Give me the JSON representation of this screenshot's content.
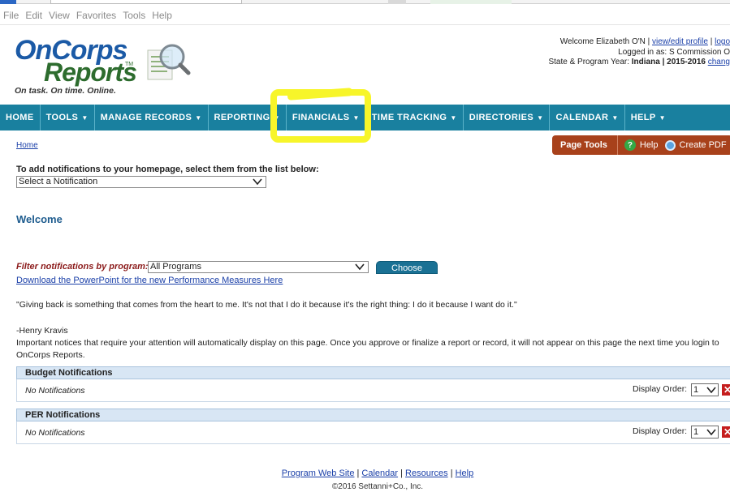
{
  "browser_menu": [
    "File",
    "Edit",
    "View",
    "Favorites",
    "Tools",
    "Help"
  ],
  "logo": {
    "line1": "OnCorps",
    "line2": "Reports",
    "tm": "TM",
    "tagline": "On task. On time. Online."
  },
  "header": {
    "welcome_prefix": "Welcome",
    "welcome_name": "Elizabeth O'N",
    "view_profile": "view/edit profile",
    "logout": "logo",
    "logged_in_label": "Logged in as:",
    "logged_in_value": "S        Commission  O",
    "state_label": "State & Program Year:",
    "state_value": "Indiana | 2015-2016",
    "change": "chang"
  },
  "nav": [
    {
      "label": "HOME",
      "caret": ""
    },
    {
      "label": "TOOLS",
      "caret": "▼"
    },
    {
      "label": "MANAGE RECORDS",
      "caret": "▼"
    },
    {
      "label": "REPORTING",
      "caret": "▼"
    },
    {
      "label": "FINANCIALS",
      "caret": "▼"
    },
    {
      "label": "TIME TRACKING",
      "caret": "▼"
    },
    {
      "label": "DIRECTORIES",
      "caret": "▼"
    },
    {
      "label": "CALENDAR",
      "caret": "▼"
    },
    {
      "label": "HELP",
      "caret": "▼"
    }
  ],
  "breadcrumb": "Home",
  "page_tools": {
    "label": "Page Tools",
    "help": "Help",
    "help_icon": "?",
    "pdf": "Create PDF"
  },
  "notifications": {
    "instruction": "To add notifications to your homepage, select them from the list below:",
    "select_value": "Select a Notification"
  },
  "welcome_heading": "Welcome",
  "filter": {
    "label": "Filter notifications by program:",
    "select_value": "All Programs",
    "button": "Choose"
  },
  "powerpoint_link": "Download the PowerPoint for the new Performance Measures Here",
  "quote": "\"Giving back is something that comes from the heart to me. It's not that I do it because it's the right thing: I do it because I want do it.\"",
  "quote_author": "-Henry Kravis",
  "important_notice": "Important notices that require your attention will automatically display on this page. Once you approve or finalize a report or record, it will not appear on this page the next time you login to OnCorps Reports.",
  "panels": [
    {
      "title": "Budget Notifications",
      "empty_text": "No Notifications",
      "order_label": "Display Order:",
      "order_value": "1"
    },
    {
      "title": "PER Notifications",
      "empty_text": "No Notifications",
      "order_label": "Display Order:",
      "order_value": "1"
    }
  ],
  "footer": {
    "links": [
      "Program Web Site",
      "Calendar",
      "Resources",
      "Help"
    ],
    "separator": "|",
    "copyright": "©2016 Settanni+Co., Inc."
  },
  "colors": {
    "nav_bg": "#19809f",
    "page_tools_bg": "#a8411b",
    "highlight": "#f7f52a",
    "link": "#1a3fa8"
  }
}
